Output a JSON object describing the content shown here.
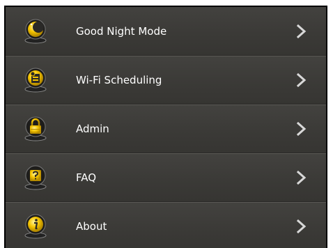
{
  "menu": {
    "items": [
      {
        "label": "Good Night Mode",
        "icon": "moon-icon"
      },
      {
        "label": "Wi-Fi Scheduling",
        "icon": "scheduling-icon"
      },
      {
        "label": "Admin",
        "icon": "lock-icon"
      },
      {
        "label": "FAQ",
        "icon": "question-icon"
      },
      {
        "label": "About",
        "icon": "info-icon"
      }
    ]
  },
  "colors": {
    "accent": "#f5c400",
    "background": "#3c3b39",
    "text": "#ffffff",
    "chevron": "#d8d8d8"
  }
}
